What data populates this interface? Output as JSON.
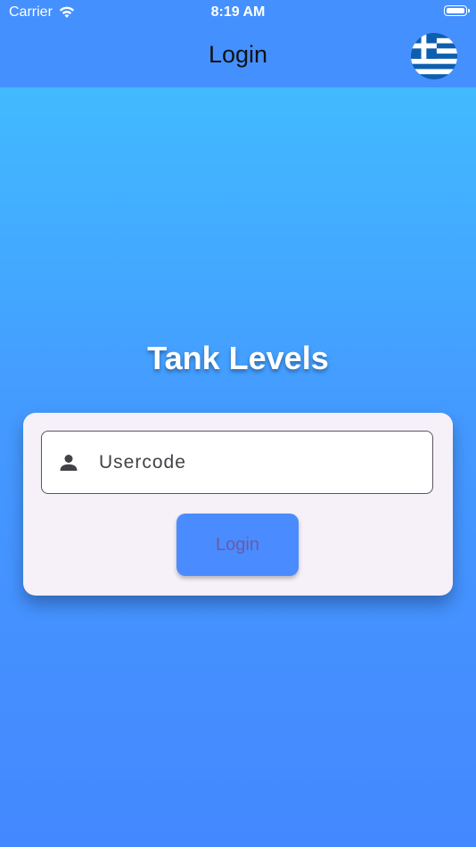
{
  "status_bar": {
    "carrier": "Carrier",
    "time": "8:19 AM",
    "icons": [
      "wifi-icon",
      "battery-icon"
    ]
  },
  "nav": {
    "title": "Login",
    "language_flag_icon": "greece-flag-icon"
  },
  "main": {
    "app_title": "Tank Levels"
  },
  "login_form": {
    "usercode_placeholder": "Usercode",
    "usercode_value": "",
    "usercode_icon": "person-icon",
    "login_button_label": "Login"
  },
  "colors": {
    "top_bar": "#4590ff",
    "background_top": "#41c3ff",
    "background_bottom": "#4488ff",
    "card": "#f6f0f8",
    "button": "#4a8cff",
    "button_text": "#6a5aa8"
  }
}
